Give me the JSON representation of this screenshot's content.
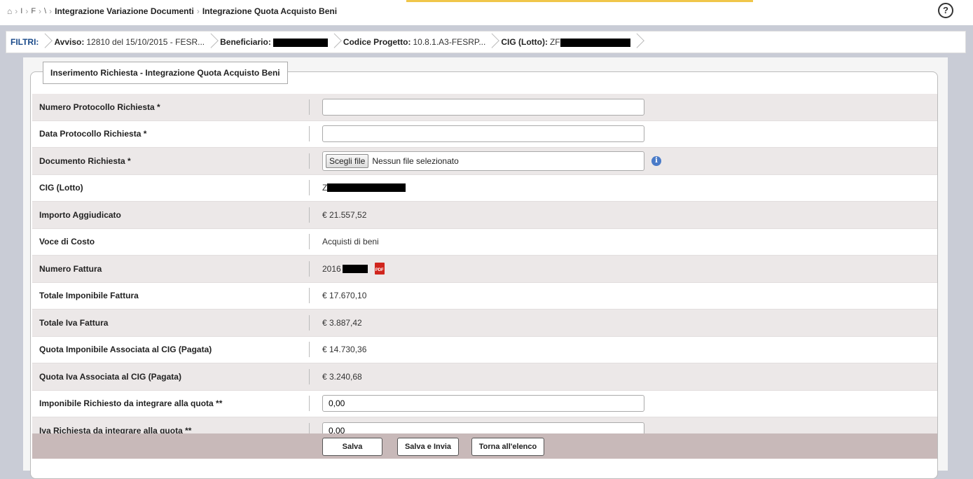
{
  "breadcrumb": {
    "items": [
      "I",
      "F",
      "\\"
    ],
    "section": "Integrazione Variazione Documenti",
    "current": "Integrazione Quota Acquisto Beni"
  },
  "help": {
    "glyph": "?"
  },
  "filters": {
    "label": "FILTRI:",
    "avviso_label": "Avviso:",
    "avviso_value": "12810 del 15/10/2015 - FESR...",
    "beneficiario_label": "Beneficiario:",
    "codice_label": "Codice Progetto:",
    "codice_value": "10.8.1.A3-FESRP...",
    "cig_label": "CIG (Lotto):",
    "cig_value": "ZF"
  },
  "form": {
    "legend": "Inserimento Richiesta - Integrazione Quota Acquisto Beni",
    "rows": [
      {
        "label": "Numero Protocollo Richiesta *",
        "value": ""
      },
      {
        "label": "Data Protocollo Richiesta *",
        "value": ""
      },
      {
        "label": "Documento Richiesta *",
        "file_button": "Scegli file",
        "file_status": "Nessun file selezionato"
      },
      {
        "label": "CIG (Lotto)",
        "value": "Z"
      },
      {
        "label": "Importo Aggiudicato",
        "value": "€ 21.557,52"
      },
      {
        "label": "Voce di Costo",
        "value": "Acquisti di beni"
      },
      {
        "label": "Numero Fattura",
        "value": "2016",
        "icon_text": "PDF"
      },
      {
        "label": "Totale Imponibile Fattura",
        "value": "€ 17.670,10"
      },
      {
        "label": "Totale Iva Fattura",
        "value": "€ 3.887,42"
      },
      {
        "label": "Quota Imponibile Associata al CIG (Pagata)",
        "value": "€ 14.730,36"
      },
      {
        "label": "Quota Iva Associata al CIG (Pagata)",
        "value": "€ 3.240,68"
      },
      {
        "label": "Imponibile Richiesto da integrare alla quota **",
        "value": "0,00"
      },
      {
        "label": "Iva Richiesta da integrare alla quota **",
        "value": "0,00"
      }
    ]
  },
  "actions": {
    "salva": "Salva",
    "salva_invia": "Salva e Invia",
    "torna": "Torna all'elenco"
  }
}
